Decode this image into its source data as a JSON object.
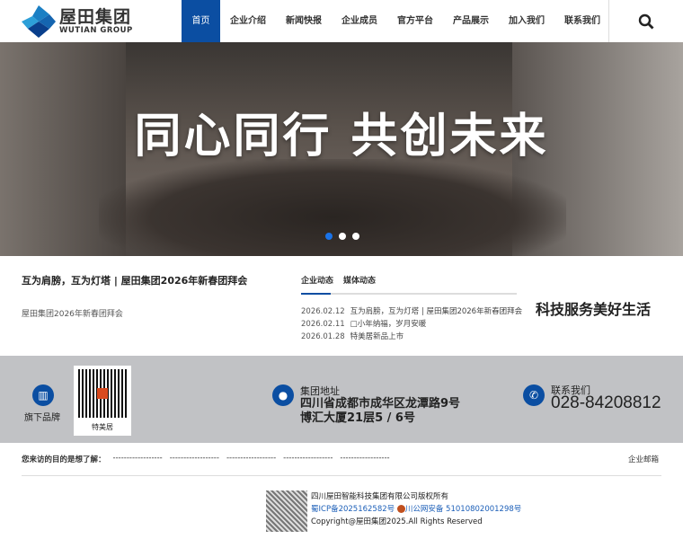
{
  "header": {
    "logo_name": "屋田集团",
    "logo_en": "WUTIAN GROUP",
    "nav": [
      "首页",
      "企业介绍",
      "新闻快报",
      "企业成员",
      "官方平台",
      "产品展示",
      "加入我们",
      "联系我们"
    ]
  },
  "hero": {
    "slogan": "同心同行 共创未来",
    "slide_count": 3,
    "active_slide": 1
  },
  "news": {
    "headline": "互为肩膀，互为灯塔 | 屋田集团2026年新春团拜会",
    "summary": "屋田集团2026年新春团拜会",
    "tabs": [
      "企业动态",
      "媒体动态"
    ],
    "items": [
      {
        "date": "2026.02.12",
        "title": "互为肩膀，互为灯塔 | 屋田集团2026年新春团拜会"
      },
      {
        "date": "2026.02.11",
        "title": "□小年纳福，岁月安暖"
      },
      {
        "date": "2026.01.28",
        "title": "特美居新品上市"
      }
    ]
  },
  "motto": "科技服务美好生活",
  "band": {
    "brands_label": "旗下品牌",
    "qr_label": "特美居",
    "address_label": "集团地址",
    "address_line1": "四川省成都市成华区龙潭路9号",
    "address_line2": "博汇大厦21层5 / 6号",
    "contact_label": "联系我们",
    "phone": "028-84208812"
  },
  "footer": {
    "visit_label": "您来访的目的是想了解：",
    "links": [
      "------------------",
      "------------------",
      "------------------",
      "------------------",
      "------------------"
    ],
    "mail": "企业邮箱",
    "company": "四川屋田智能科技集团有限公司版权所有",
    "icp": "蜀ICP备2025162582号",
    "police": "川公网安备 51010802001298号",
    "copyright": "Copyright@屋田集团2025.All Rights Reserved"
  }
}
